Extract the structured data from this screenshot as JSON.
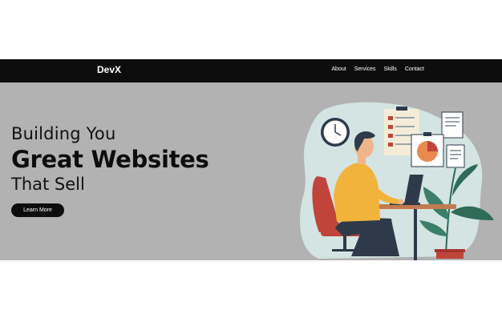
{
  "header": {
    "brand": "DevX",
    "nav": [
      {
        "label": "About"
      },
      {
        "label": "Services"
      },
      {
        "label": "Skills"
      },
      {
        "label": "Contact"
      }
    ]
  },
  "hero": {
    "line1": "Building You",
    "line2": "Great Websites",
    "line3": "That Sell",
    "cta_label": "Learn More"
  },
  "colors": {
    "navbar": "#0d0d0d",
    "hero_bg": "#b2b2b2",
    "blob": "#d3e4e2",
    "shirt": "#f2b33c",
    "chair": "#c0443a",
    "plant": "#2f6b57"
  }
}
